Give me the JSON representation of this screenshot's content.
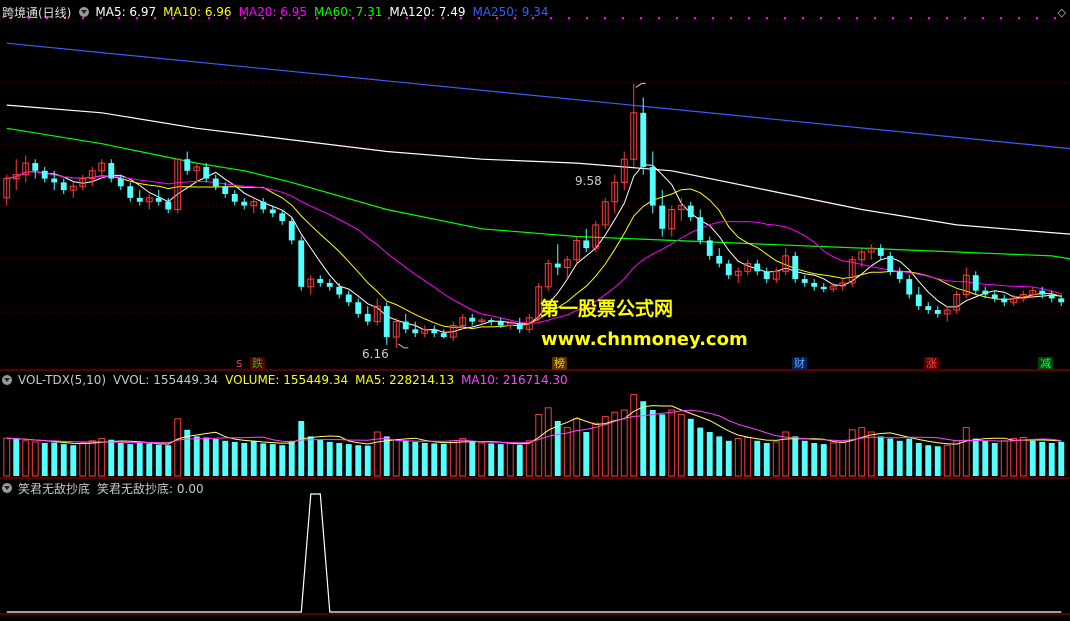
{
  "colors": {
    "up": "#ff3b3b",
    "down": "#54ffff",
    "ma5": "#ffffff",
    "ma10": "#ffff00",
    "ma20": "#ff00ff",
    "ma60": "#00ff00",
    "ma120": "#ffffff",
    "ma250": "#3b5bff",
    "vma5": "#ffff66",
    "vma10": "#ff44ff",
    "axis": "#b00000",
    "signal": "#ffffff"
  },
  "price_panel": {
    "title": "跨境通(日线)",
    "ma_labels": [
      {
        "text": "MA5: 6.97",
        "color": "#ffffff"
      },
      {
        "text": "MA10: 6.96",
        "color": "#ffff00"
      },
      {
        "text": "MA20: 6.95",
        "color": "#ff00ff"
      },
      {
        "text": "MA60: 7.31",
        "color": "#00ff00"
      },
      {
        "text": "MA120: 7.49",
        "color": "#ffffff"
      },
      {
        "text": "MA250: 9.34",
        "color": "#3b5bff"
      }
    ],
    "high_label": "9.58",
    "low_label": "6.16",
    "events": [
      {
        "text": "跌",
        "color": "#00cc00",
        "bg": "#550000"
      },
      {
        "text": "榜",
        "color": "#ffcc00",
        "bg": "#553300"
      },
      {
        "text": "财",
        "color": "#66aaff",
        "bg": "#002255"
      },
      {
        "text": "涨",
        "color": "#ff4444",
        "bg": "#550000"
      },
      {
        "text": "减",
        "color": "#00ff66",
        "bg": "#004400"
      }
    ],
    "small_mark": "S"
  },
  "watermark": {
    "line1": "第一股票公式网",
    "line2": "www.chnmoney.com"
  },
  "volume_panel": {
    "labels": [
      {
        "text": "VOL-TDX(5,10)",
        "color": "#c8c8c8"
      },
      {
        "text": "VVOL: 155449.34",
        "color": "#c8c8c8"
      },
      {
        "text": "VOLUME: 155449.34",
        "color": "#ffff00"
      },
      {
        "text": "MA5: 228214.13",
        "color": "#ffff00"
      },
      {
        "text": "MA10: 216714.30",
        "color": "#ff44ff"
      }
    ]
  },
  "indicator_panel": {
    "labels": [
      {
        "text": "笑君无敌抄底",
        "color": "#c8c8c8"
      },
      {
        "text": "笑君无敌抄底: 0.00",
        "color": "#c8c8c8"
      }
    ]
  },
  "chart_data": {
    "type": "candlestick",
    "symbol": "跨境通",
    "period": "日线",
    "price_ylim": [
      5.9,
      10.4
    ],
    "candles": [
      [
        8.1,
        8.4,
        8.0,
        8.35
      ],
      [
        8.35,
        8.6,
        8.2,
        8.4
      ],
      [
        8.4,
        8.65,
        8.3,
        8.55
      ],
      [
        8.55,
        8.6,
        8.35,
        8.45
      ],
      [
        8.45,
        8.5,
        8.3,
        8.35
      ],
      [
        8.35,
        8.45,
        8.2,
        8.3
      ],
      [
        8.3,
        8.35,
        8.15,
        8.2
      ],
      [
        8.2,
        8.3,
        8.1,
        8.25
      ],
      [
        8.25,
        8.4,
        8.2,
        8.35
      ],
      [
        8.35,
        8.5,
        8.25,
        8.45
      ],
      [
        8.45,
        8.6,
        8.35,
        8.55
      ],
      [
        8.55,
        8.6,
        8.3,
        8.35
      ],
      [
        8.35,
        8.4,
        8.2,
        8.25
      ],
      [
        8.25,
        8.3,
        8.05,
        8.1
      ],
      [
        8.1,
        8.2,
        8.0,
        8.05
      ],
      [
        8.05,
        8.15,
        7.95,
        8.1
      ],
      [
        8.1,
        8.2,
        8.0,
        8.05
      ],
      [
        8.05,
        8.1,
        7.9,
        7.95
      ],
      [
        7.95,
        8.6,
        7.9,
        8.6
      ],
      [
        8.6,
        8.7,
        8.4,
        8.45
      ],
      [
        8.45,
        8.55,
        8.3,
        8.5
      ],
      [
        8.5,
        8.55,
        8.3,
        8.35
      ],
      [
        8.35,
        8.4,
        8.2,
        8.25
      ],
      [
        8.25,
        8.3,
        8.1,
        8.15
      ],
      [
        8.15,
        8.2,
        8.0,
        8.05
      ],
      [
        8.05,
        8.1,
        7.95,
        8.0
      ],
      [
        8.0,
        8.1,
        7.9,
        8.05
      ],
      [
        8.05,
        8.1,
        7.9,
        7.95
      ],
      [
        7.95,
        8.0,
        7.85,
        7.9
      ],
      [
        7.9,
        7.95,
        7.75,
        7.8
      ],
      [
        7.8,
        7.85,
        7.5,
        7.55
      ],
      [
        7.55,
        7.6,
        6.9,
        6.95
      ],
      [
        6.95,
        7.1,
        6.85,
        7.05
      ],
      [
        7.05,
        7.1,
        6.95,
        7.0
      ],
      [
        7.0,
        7.05,
        6.9,
        6.95
      ],
      [
        6.95,
        7.0,
        6.8,
        6.85
      ],
      [
        6.85,
        6.9,
        6.7,
        6.75
      ],
      [
        6.75,
        6.8,
        6.55,
        6.6
      ],
      [
        6.6,
        6.7,
        6.45,
        6.5
      ],
      [
        6.5,
        6.8,
        6.45,
        6.7
      ],
      [
        6.7,
        6.75,
        6.2,
        6.3
      ],
      [
        6.3,
        6.55,
        6.16,
        6.5
      ],
      [
        6.5,
        6.6,
        6.35,
        6.4
      ],
      [
        6.4,
        6.5,
        6.3,
        6.35
      ],
      [
        6.35,
        6.45,
        6.3,
        6.4
      ],
      [
        6.4,
        6.45,
        6.3,
        6.35
      ],
      [
        6.35,
        6.4,
        6.28,
        6.3
      ],
      [
        6.3,
        6.5,
        6.25,
        6.45
      ],
      [
        6.45,
        6.6,
        6.4,
        6.55
      ],
      [
        6.55,
        6.6,
        6.45,
        6.5
      ],
      [
        6.5,
        6.55,
        6.45,
        6.52
      ],
      [
        6.52,
        6.55,
        6.45,
        6.5
      ],
      [
        6.5,
        6.55,
        6.42,
        6.45
      ],
      [
        6.45,
        6.5,
        6.4,
        6.48
      ],
      [
        6.48,
        6.55,
        6.35,
        6.4
      ],
      [
        6.4,
        6.6,
        6.35,
        6.55
      ],
      [
        6.55,
        7.0,
        6.5,
        6.95
      ],
      [
        6.95,
        7.3,
        6.9,
        7.25
      ],
      [
        7.25,
        7.5,
        7.1,
        7.2
      ],
      [
        7.2,
        7.35,
        7.05,
        7.3
      ],
      [
        7.3,
        7.6,
        7.25,
        7.55
      ],
      [
        7.55,
        7.7,
        7.4,
        7.45
      ],
      [
        7.45,
        7.8,
        7.4,
        7.75
      ],
      [
        7.75,
        8.1,
        7.7,
        8.05
      ],
      [
        8.05,
        8.4,
        7.9,
        8.3
      ],
      [
        8.3,
        8.7,
        8.2,
        8.6
      ],
      [
        8.6,
        9.58,
        8.5,
        9.2
      ],
      [
        9.2,
        9.4,
        8.4,
        8.5
      ],
      [
        8.5,
        8.7,
        7.9,
        8.0
      ],
      [
        8.0,
        8.2,
        7.6,
        7.7
      ],
      [
        7.7,
        8.0,
        7.6,
        7.95
      ],
      [
        7.95,
        8.1,
        7.8,
        8.0
      ],
      [
        8.0,
        8.05,
        7.8,
        7.85
      ],
      [
        7.85,
        7.95,
        7.5,
        7.55
      ],
      [
        7.55,
        7.6,
        7.3,
        7.35
      ],
      [
        7.35,
        7.45,
        7.2,
        7.25
      ],
      [
        7.25,
        7.3,
        7.05,
        7.1
      ],
      [
        7.1,
        7.2,
        7.0,
        7.15
      ],
      [
        7.15,
        7.3,
        7.1,
        7.25
      ],
      [
        7.25,
        7.3,
        7.1,
        7.15
      ],
      [
        7.15,
        7.2,
        7.0,
        7.05
      ],
      [
        7.05,
        7.2,
        7.0,
        7.15
      ],
      [
        7.15,
        7.45,
        7.1,
        7.35
      ],
      [
        7.35,
        7.4,
        7.0,
        7.05
      ],
      [
        7.05,
        7.1,
        6.95,
        7.0
      ],
      [
        7.0,
        7.05,
        6.9,
        6.95
      ],
      [
        6.95,
        7.0,
        6.88,
        6.92
      ],
      [
        6.92,
        7.0,
        6.88,
        6.96
      ],
      [
        6.96,
        7.05,
        6.9,
        7.0
      ],
      [
        7.0,
        7.35,
        6.95,
        7.3
      ],
      [
        7.3,
        7.45,
        7.2,
        7.4
      ],
      [
        7.4,
        7.5,
        7.3,
        7.45
      ],
      [
        7.45,
        7.5,
        7.3,
        7.35
      ],
      [
        7.35,
        7.4,
        7.1,
        7.15
      ],
      [
        7.15,
        7.2,
        7.0,
        7.05
      ],
      [
        7.05,
        7.1,
        6.8,
        6.85
      ],
      [
        6.85,
        6.95,
        6.65,
        6.7
      ],
      [
        6.7,
        6.75,
        6.6,
        6.65
      ],
      [
        6.65,
        6.7,
        6.55,
        6.6
      ],
      [
        6.6,
        6.7,
        6.5,
        6.65
      ],
      [
        6.65,
        6.9,
        6.6,
        6.85
      ],
      [
        6.85,
        7.2,
        6.8,
        7.1
      ],
      [
        7.1,
        7.15,
        6.85,
        6.9
      ],
      [
        6.9,
        6.95,
        6.8,
        6.85
      ],
      [
        6.85,
        6.9,
        6.75,
        6.8
      ],
      [
        6.8,
        6.85,
        6.7,
        6.75
      ],
      [
        6.75,
        6.85,
        6.7,
        6.8
      ],
      [
        6.8,
        6.9,
        6.75,
        6.85
      ],
      [
        6.85,
        6.95,
        6.8,
        6.9
      ],
      [
        6.9,
        6.95,
        6.8,
        6.85
      ],
      [
        6.85,
        6.9,
        6.75,
        6.8
      ],
      [
        6.8,
        6.85,
        6.7,
        6.75
      ]
    ],
    "ma250": [
      [
        0,
        10.1
      ],
      [
        115,
        8.7
      ]
    ],
    "ma120": [
      [
        0,
        9.3
      ],
      [
        10,
        9.2
      ],
      [
        20,
        9.0
      ],
      [
        30,
        8.85
      ],
      [
        40,
        8.7
      ],
      [
        50,
        8.6
      ],
      [
        60,
        8.55
      ],
      [
        70,
        8.45
      ],
      [
        80,
        8.2
      ],
      [
        90,
        7.95
      ],
      [
        100,
        7.75
      ],
      [
        115,
        7.6
      ]
    ],
    "ma60": [
      [
        0,
        9.0
      ],
      [
        10,
        8.8
      ],
      [
        20,
        8.55
      ],
      [
        25,
        8.45
      ],
      [
        30,
        8.3
      ],
      [
        40,
        7.95
      ],
      [
        50,
        7.7
      ],
      [
        60,
        7.6
      ],
      [
        70,
        7.55
      ],
      [
        80,
        7.5
      ],
      [
        90,
        7.45
      ],
      [
        100,
        7.4
      ],
      [
        110,
        7.35
      ],
      [
        115,
        7.25
      ]
    ],
    "volume": [
      [
        172,
        1
      ],
      [
        168,
        0
      ],
      [
        160,
        1
      ],
      [
        155,
        1
      ],
      [
        150,
        0
      ],
      [
        152,
        0
      ],
      [
        145,
        0
      ],
      [
        140,
        0
      ],
      [
        150,
        1
      ],
      [
        160,
        1
      ],
      [
        170,
        1
      ],
      [
        165,
        0
      ],
      [
        150,
        0
      ],
      [
        145,
        0
      ],
      [
        150,
        0
      ],
      [
        148,
        0
      ],
      [
        142,
        0
      ],
      [
        140,
        0
      ],
      [
        260,
        1
      ],
      [
        210,
        0
      ],
      [
        180,
        0
      ],
      [
        175,
        0
      ],
      [
        168,
        0
      ],
      [
        160,
        0
      ],
      [
        155,
        0
      ],
      [
        150,
        0
      ],
      [
        160,
        0
      ],
      [
        148,
        0
      ],
      [
        145,
        0
      ],
      [
        140,
        0
      ],
      [
        160,
        0
      ],
      [
        250,
        0
      ],
      [
        180,
        0
      ],
      [
        165,
        0
      ],
      [
        155,
        0
      ],
      [
        150,
        0
      ],
      [
        145,
        0
      ],
      [
        140,
        0
      ],
      [
        138,
        0
      ],
      [
        200,
        1
      ],
      [
        180,
        0
      ],
      [
        165,
        1
      ],
      [
        160,
        0
      ],
      [
        155,
        0
      ],
      [
        150,
        0
      ],
      [
        148,
        0
      ],
      [
        146,
        0
      ],
      [
        160,
        1
      ],
      [
        170,
        1
      ],
      [
        155,
        0
      ],
      [
        150,
        1
      ],
      [
        148,
        0
      ],
      [
        145,
        0
      ],
      [
        150,
        1
      ],
      [
        142,
        0
      ],
      [
        160,
        1
      ],
      [
        280,
        1
      ],
      [
        310,
        1
      ],
      [
        250,
        0
      ],
      [
        220,
        1
      ],
      [
        260,
        1
      ],
      [
        200,
        0
      ],
      [
        240,
        1
      ],
      [
        270,
        1
      ],
      [
        290,
        1
      ],
      [
        300,
        1
      ],
      [
        370,
        1
      ],
      [
        340,
        0
      ],
      [
        300,
        0
      ],
      [
        280,
        0
      ],
      [
        300,
        1
      ],
      [
        280,
        1
      ],
      [
        260,
        0
      ],
      [
        220,
        0
      ],
      [
        200,
        0
      ],
      [
        180,
        0
      ],
      [
        160,
        0
      ],
      [
        170,
        1
      ],
      [
        175,
        1
      ],
      [
        160,
        0
      ],
      [
        150,
        0
      ],
      [
        155,
        1
      ],
      [
        200,
        1
      ],
      [
        180,
        0
      ],
      [
        160,
        0
      ],
      [
        150,
        0
      ],
      [
        145,
        0
      ],
      [
        150,
        1
      ],
      [
        155,
        1
      ],
      [
        210,
        1
      ],
      [
        220,
        1
      ],
      [
        200,
        1
      ],
      [
        180,
        0
      ],
      [
        170,
        0
      ],
      [
        160,
        0
      ],
      [
        170,
        0
      ],
      [
        150,
        0
      ],
      [
        140,
        0
      ],
      [
        135,
        0
      ],
      [
        140,
        1
      ],
      [
        160,
        1
      ],
      [
        220,
        1
      ],
      [
        170,
        0
      ],
      [
        160,
        0
      ],
      [
        150,
        0
      ],
      [
        160,
        1
      ],
      [
        170,
        1
      ],
      [
        175,
        1
      ],
      [
        160,
        0
      ],
      [
        155,
        0
      ],
      [
        150,
        0
      ],
      [
        155,
        0
      ]
    ],
    "volume_ylim": [
      0,
      400000
    ],
    "signal": [
      {
        "index": 32,
        "value": 1
      },
      {
        "index": 33,
        "value": 1
      }
    ],
    "signal_ylim": [
      0,
      1
    ]
  }
}
